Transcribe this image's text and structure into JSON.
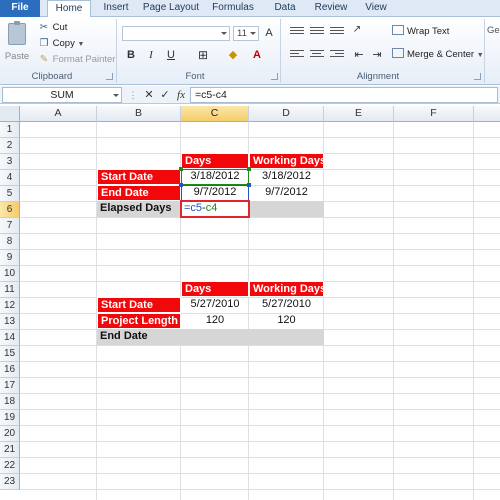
{
  "ribbon": {
    "tabs": [
      "File",
      "Home",
      "Insert",
      "Page Layout",
      "Formulas",
      "Data",
      "Review",
      "View"
    ],
    "clipboard": {
      "paste": "Paste",
      "cut": "Cut",
      "copy": "Copy",
      "format_painter": "Format Painter",
      "group_label": "Clipboard"
    },
    "font": {
      "size": "11",
      "bold": "B",
      "italic": "I",
      "underline": "U",
      "group_label": "Font"
    },
    "alignment": {
      "wrap_text": "Wrap Text",
      "merge_center": "Merge & Center",
      "group_label": "Alignment"
    },
    "general_clip": "Ge"
  },
  "formula_bar": {
    "name_box": "SUM",
    "cancel": "✕",
    "enter": "✓",
    "fx": "fx",
    "formula": "=c5-c4"
  },
  "columns": [
    "A",
    "B",
    "C",
    "D",
    "E",
    "F"
  ],
  "rows": [
    "1",
    "2",
    "3",
    "4",
    "5",
    "6",
    "7",
    "8",
    "9",
    "10",
    "11",
    "12",
    "13",
    "14",
    "15",
    "16",
    "17",
    "18",
    "19",
    "20",
    "21",
    "22",
    "23"
  ],
  "table1": {
    "headers": [
      "Days",
      "Working Days"
    ],
    "rows": [
      {
        "label": "Start Date",
        "days": "3/18/2012",
        "working": "3/18/2012"
      },
      {
        "label": "End Date",
        "days": "9/7/2012",
        "working": "9/7/2012"
      }
    ],
    "elapsed_label": "Elapsed Days",
    "editing": {
      "part1": "=c5",
      "part2": "-",
      "part3": "c4"
    }
  },
  "table2": {
    "headers": [
      "Days",
      "Working Days"
    ],
    "rows": [
      {
        "label": "Start Date",
        "days": "5/27/2010",
        "working": "5/27/2010"
      },
      {
        "label": "Project Length",
        "days": "120",
        "working": "120"
      }
    ],
    "end_label": "End Date"
  },
  "colors": {
    "header_red": "#f2070b",
    "total_gray": "#d6d6d6",
    "edit_border": "#e0262c"
  }
}
